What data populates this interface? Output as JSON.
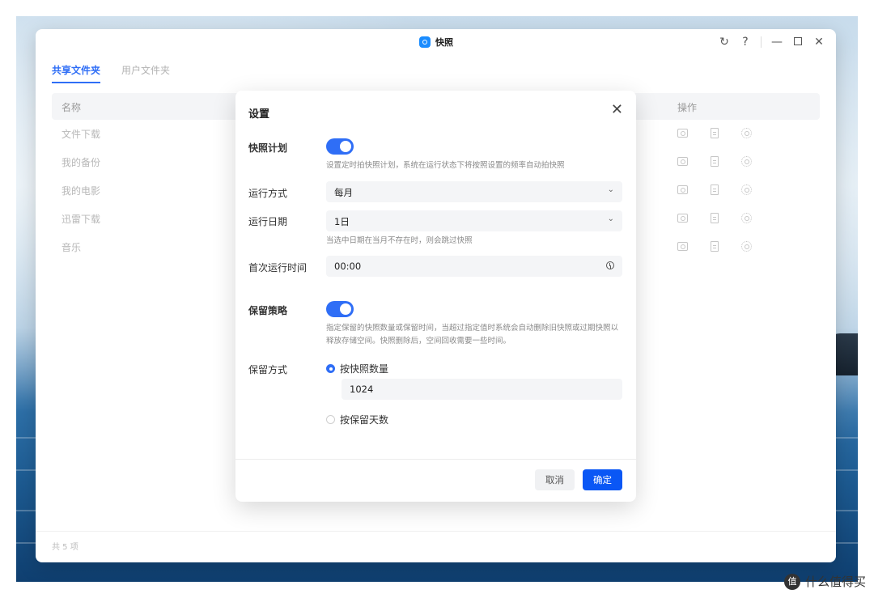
{
  "window": {
    "title": "快照"
  },
  "tabs": [
    {
      "label": "共享文件夹",
      "active": true
    },
    {
      "label": "用户文件夹",
      "active": false
    }
  ],
  "table": {
    "columns": {
      "name": "名称",
      "ops": "操作"
    },
    "rows": [
      {
        "name": "文件下载"
      },
      {
        "name": "我的备份"
      },
      {
        "name": "我的电影"
      },
      {
        "name": "迅雷下载"
      },
      {
        "name": "音乐"
      }
    ]
  },
  "footer": {
    "count": "共 5 项"
  },
  "dialog": {
    "title": "设置",
    "schedule": {
      "label": "快照计划",
      "enabled": true,
      "hint": "设置定时拍快照计划，系统在运行状态下将按照设置的频率自动拍快照"
    },
    "run_mode": {
      "label": "运行方式",
      "value": "每月"
    },
    "run_date": {
      "label": "运行日期",
      "value": "1日",
      "hint": "当选中日期在当月不存在时，则会跳过快照"
    },
    "first_run": {
      "label": "首次运行时间",
      "value": "00:00"
    },
    "retention": {
      "label": "保留策略",
      "enabled": true,
      "hint": "指定保留的快照数量或保留时间，当超过指定值时系统会自动删除旧快照或过期快照以释放存储空间。快照删除后，空间回收需要一些时间。"
    },
    "retention_mode": {
      "label": "保留方式",
      "options": [
        {
          "label": "按快照数量",
          "checked": true
        },
        {
          "label": "按保留天数",
          "checked": false
        }
      ],
      "count_value": "1024"
    },
    "cancel_label": "取消",
    "ok_label": "确定"
  },
  "watermark": {
    "text": "什么值得买",
    "logo": "值"
  },
  "colors": {
    "accent": "#2f6ef6",
    "primary_button": "#0a57f5"
  }
}
